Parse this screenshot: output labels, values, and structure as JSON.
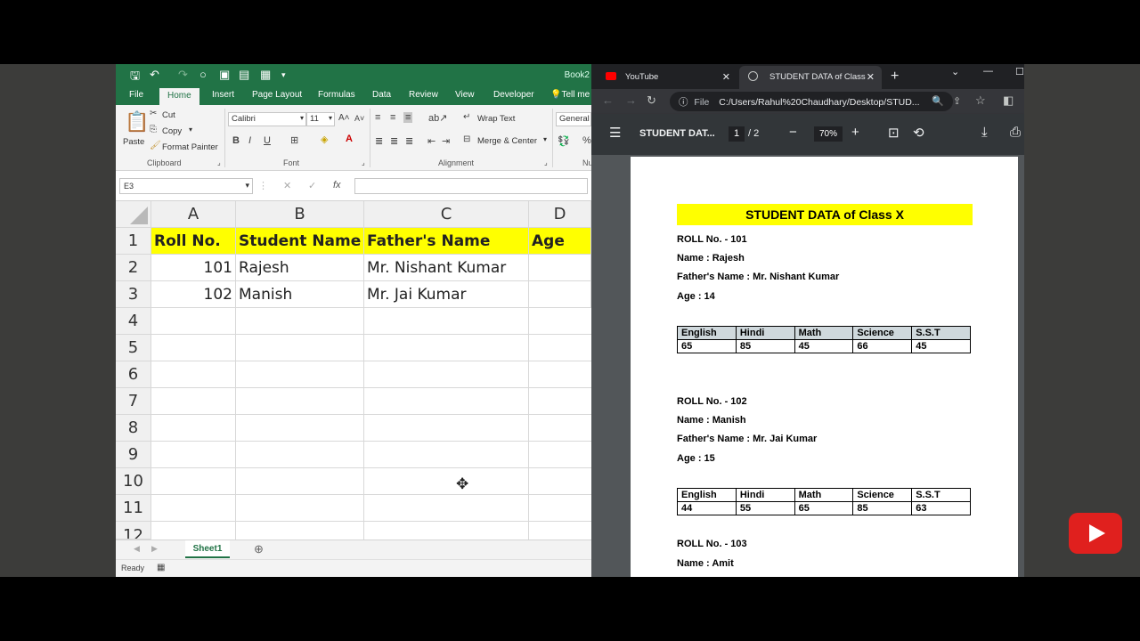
{
  "excel": {
    "workbook_name": "Book2",
    "tabs": [
      "File",
      "Home",
      "Insert",
      "Page Layout",
      "Formulas",
      "Data",
      "Review",
      "View",
      "Developer",
      "Tell me"
    ],
    "clipboard": {
      "paste": "Paste",
      "cut": "Cut",
      "copy": "Copy",
      "format_painter": "Format Painter",
      "group": "Clipboard"
    },
    "font": {
      "name": "Calibri",
      "size": "11",
      "group": "Font"
    },
    "alignment": {
      "wrap_text": "Wrap Text",
      "merge_center": "Merge & Center",
      "group": "Alignment"
    },
    "number": {
      "format": "General",
      "group_partial": "Nu"
    },
    "name_box": "E3",
    "columns": [
      "A",
      "B",
      "C",
      "D"
    ],
    "rows": [
      "1",
      "2",
      "3",
      "4",
      "5",
      "6",
      "7",
      "8",
      "9",
      "10",
      "11",
      "12"
    ],
    "header_row": [
      "Roll No.",
      "Student Name",
      "Father's Name",
      "Age"
    ],
    "data_rows": [
      [
        "101",
        "Rajesh",
        "Mr. Nishant Kumar",
        ""
      ],
      [
        "102",
        "Manish",
        "Mr. Jai Kumar",
        ""
      ]
    ],
    "sheet_tab": "Sheet1",
    "status": "Ready"
  },
  "browser": {
    "tabs": [
      {
        "title": "YouTube"
      },
      {
        "title": "STUDENT DATA of Class X"
      }
    ],
    "url_scheme": "File",
    "url": "C:/Users/Rahul%20Chaudhary/Desktop/STUD...",
    "pdf": {
      "title": "STUDENT DAT...",
      "current_page": "1",
      "total_pages": "/ 2",
      "zoom": "70%"
    }
  },
  "document": {
    "title": "STUDENT DATA of Class X",
    "students": [
      {
        "roll": "ROLL No. - 101",
        "name": "Name : Rajesh",
        "father": "Father's Name : Mr. Nishant Kumar",
        "age": "Age : 14",
        "subjects": [
          "English",
          "Hindi",
          "Math",
          "Science",
          "S.S.T"
        ],
        "marks": [
          "65",
          "85",
          "45",
          "66",
          "45"
        ]
      },
      {
        "roll": "ROLL No. - 102",
        "name": "Name : Manish",
        "father": "Father's Name : Mr. Jai Kumar",
        "age": "Age : 15",
        "subjects": [
          "English",
          "Hindi",
          "Math",
          "Science",
          "S.S.T"
        ],
        "marks": [
          "44",
          "55",
          "65",
          "85",
          "63"
        ]
      },
      {
        "roll": "ROLL No. - 103",
        "name": "Name : Amit"
      }
    ]
  },
  "colors": {
    "excel_green": "#217346",
    "highlight": "#ffff00",
    "yt_red": "#e0201e"
  }
}
